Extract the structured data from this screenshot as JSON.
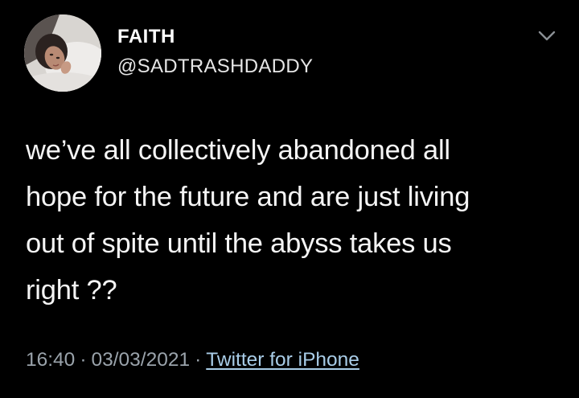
{
  "tweet": {
    "author": {
      "display_name": "FAITH",
      "handle": "@SADTRASHDADDY"
    },
    "text": "we’ve all collectively abandoned all\nhope for the future and are just living\nout of spite until the abyss takes us\nright ??",
    "time": "16:40",
    "separator": "·",
    "date": "03/03/2021",
    "source": "Twitter for iPhone"
  },
  "icons": {
    "more": "chevron-down-icon"
  },
  "colors": {
    "background": "#000000",
    "text": "#f5f5f5",
    "meta": "#9aa3ab",
    "link": "#a9cde8"
  }
}
